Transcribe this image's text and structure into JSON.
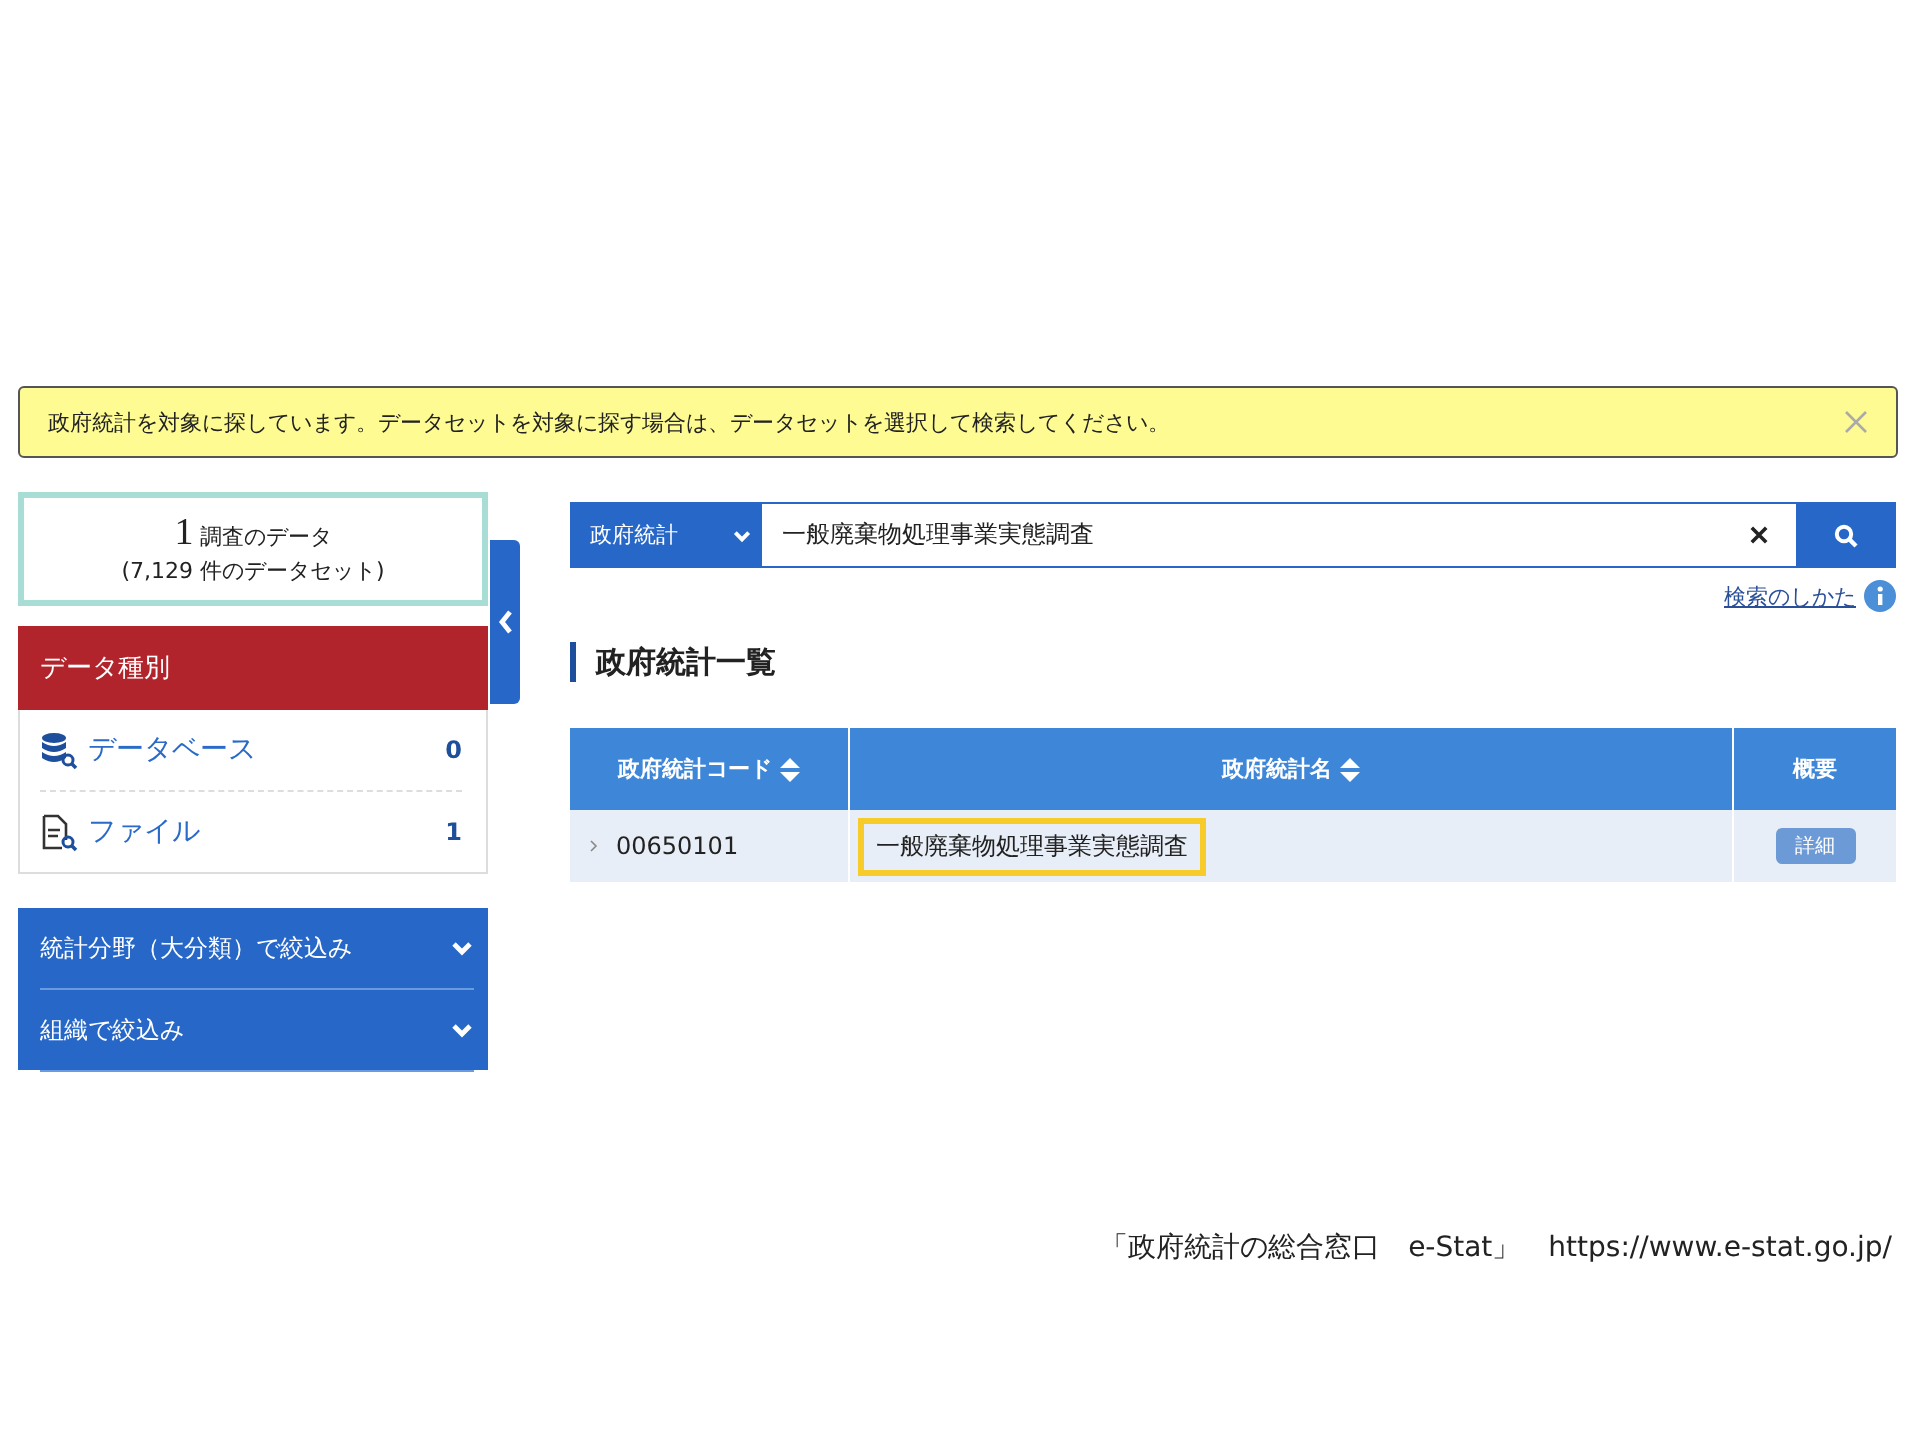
{
  "notice": {
    "text": "政府統計を対象に探しています。データセットを対象に探す場合は、データセットを選択して検索してください。"
  },
  "summary": {
    "count": "1",
    "count_label": "調査のデータ",
    "datasets": "(7,129 件のデータセット)"
  },
  "data_types": {
    "title": "データ種別",
    "items": [
      {
        "kind": "database",
        "label": "データベース",
        "count": "0"
      },
      {
        "kind": "file",
        "label": "ファイル",
        "count": "1"
      }
    ]
  },
  "filters": [
    {
      "label": "統計分野（大分類）で絞込み",
      "expanded": false
    },
    {
      "label": "組織で絞込み",
      "expanded": false
    }
  ],
  "search": {
    "scope": "政府統計",
    "value": "一般廃棄物処理事業実態調査",
    "help_link": "検索のしかた"
  },
  "section_title": "政府統計一覧",
  "table": {
    "columns": [
      {
        "label": "政府統計コード",
        "sortable": true
      },
      {
        "label": "政府統計名",
        "sortable": true
      },
      {
        "label": "概要",
        "sortable": false
      }
    ],
    "rows": [
      {
        "code": "00650101",
        "name": "一般廃棄物処理事業実態調査",
        "highlighted": true,
        "action": "詳細"
      }
    ]
  },
  "caption": "「政府統計の総合窓口　e-Stat」　https://www.e-stat.go.jp/"
}
